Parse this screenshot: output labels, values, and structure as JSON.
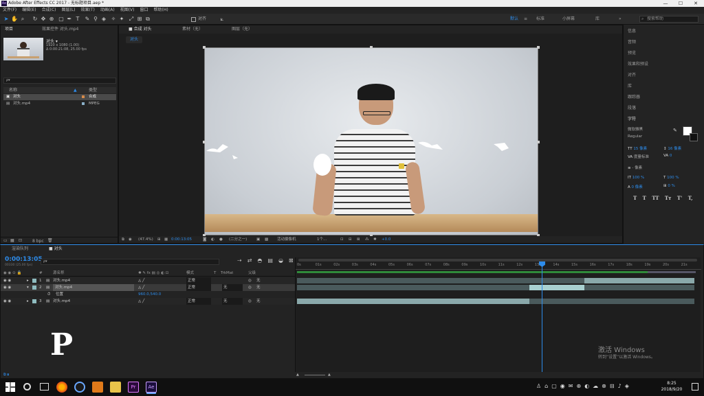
{
  "title_bar": {
    "title": "Adobe After Effects CC 2017 - 无标题项目.aep *",
    "app_icon": "Ae",
    "min": "—",
    "max": "☐",
    "close": "✕"
  },
  "menu": [
    "文件(F)",
    "编辑(E)",
    "合成(C)",
    "图层(L)",
    "效果(T)",
    "动画(A)",
    "视图(V)",
    "窗口",
    "帮助(H)"
  ],
  "toolbar": {
    "snap_label": "对齐",
    "workspaces": [
      "默认",
      "≡",
      "标准",
      "小屏幕",
      "库",
      "»"
    ],
    "search_placeholder": "搜索帮助"
  },
  "project_panel": {
    "tab_label": "项目",
    "tab2_label": "效果控件 对头.mp4",
    "thumb_name": "对头 ▾",
    "thumb_info1": "1920 x 1080 (1.00)",
    "thumb_info2": "Δ 0:00:21:08, 25.00 fps",
    "search_placeholder": "ρ▾",
    "col_name": "名称",
    "col_type": "类型",
    "items": [
      {
        "name": "对头",
        "type": "合成"
      },
      {
        "name": "对头.mp4",
        "type": "MPEG"
      }
    ],
    "footer_bpc": "8 bpc"
  },
  "comp_panel": {
    "tab_label": "合成 对头",
    "tab_footage": "素材（无）",
    "tab_layer": "图层（无）",
    "breadcrumb": "对头",
    "footer": {
      "zoom": "(47.4%)",
      "timecode": "0:00:13:05",
      "resolution": "(二分之一)",
      "camera": "活动摄像机",
      "views": "1个...",
      "exposure": "+0.0"
    }
  },
  "right_panel": {
    "items": [
      "信息",
      "音频",
      "预览",
      "效果和预设",
      "对齐",
      "库",
      "跟踪器",
      "段落",
      "字符"
    ],
    "char": {
      "font": "微软雅黑",
      "style": "Regular",
      "size": "15 像素",
      "leading": "16 像素",
      "kerning": "度量标准",
      "tracking": "0",
      "stroke": "- 像素",
      "vscale": "100 %",
      "hscale": "100 %",
      "baseline": "0 像素",
      "tsume": "0 %",
      "styles": [
        "T",
        "T",
        "TT",
        "Tт",
        "T'",
        "T,"
      ]
    }
  },
  "timeline": {
    "tab_render": "渲染队列",
    "tab_comp": "对头",
    "timecode": "0:00:13:05",
    "timecode_sub": "00330 (25.00 fps)",
    "search_placeholder": "ρ▾",
    "headers": {
      "num": "#",
      "name": "源名称",
      "mode": "模式",
      "trkmat": "TrkMat",
      "parent": "父级",
      "t": "T"
    },
    "ticks": [
      "0s",
      "01s",
      "02s",
      "03s",
      "04s",
      "05s",
      "06s",
      "07s",
      "08s",
      "09s",
      "10s",
      "11s",
      "12s",
      "13s",
      "14s",
      "15s",
      "16s",
      "17s",
      "18s",
      "19s",
      "20s",
      "21s"
    ],
    "layers": [
      {
        "num": "1",
        "name": "对头.mp4",
        "mode": "正常",
        "trkmat": "",
        "parent": "无"
      },
      {
        "num": "2",
        "name": "对头.mp4",
        "mode": "正常",
        "trkmat": "无",
        "parent": "无"
      },
      {
        "num": "",
        "name": "位置",
        "mode": "",
        "trkmat": "",
        "parent": "",
        "value": "960.0,540.0"
      },
      {
        "num": "3",
        "name": "对头.mp4",
        "mode": "正常",
        "trkmat": "无",
        "parent": "无"
      }
    ],
    "footer": "切换开关/模式"
  },
  "overlay_letter": "P",
  "watermark": {
    "line1": "激活 Windows",
    "line2": "转到“设置”以激活 Windows。"
  },
  "taskbar": {
    "time": "8:25",
    "date": "2018/9/20"
  }
}
